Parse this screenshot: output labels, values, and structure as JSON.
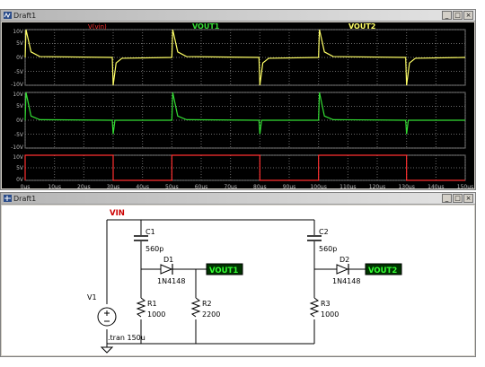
{
  "waveform_window": {
    "title": "Draft1",
    "controls": [
      "_",
      "□",
      "×"
    ],
    "traces": [
      {
        "label": "V(vin)",
        "color": "#ff3030"
      },
      {
        "label": "VOUT1",
        "color": "#33dd33"
      },
      {
        "label": "VOUT2",
        "color": "#ffff66"
      }
    ],
    "pane_ticks": {
      "top": [
        "10V",
        "5V",
        "0V",
        "-5V",
        "-10V"
      ],
      "middle": [
        "10V",
        "5V",
        "0V",
        "-5V",
        "-10V"
      ],
      "bottom": [
        "10V",
        "5V",
        "0V"
      ]
    },
    "x_ticks": [
      "0µs",
      "10µs",
      "20µs",
      "30µs",
      "40µs",
      "50µs",
      "60µs",
      "70µs",
      "80µs",
      "90µs",
      "100µs",
      "110µs",
      "120µs",
      "130µs",
      "140µs",
      "150µs"
    ],
    "colors": {
      "vin": "#ff3030",
      "vout1": "#33dd33",
      "vout2": "#ffff66",
      "grid": "#6a6a6a",
      "tick_text": "#bbbbbb"
    }
  },
  "chart_data": [
    {
      "type": "line",
      "series": [
        {
          "name": "VOUT2",
          "x": [
            0,
            0.3,
            2,
            5,
            29.7,
            30,
            31,
            33,
            50,
            50.3,
            52,
            55,
            79.7,
            80,
            81,
            83,
            100,
            100.3,
            102,
            105,
            129.7,
            130,
            131,
            133,
            150
          ],
          "y": [
            0,
            10,
            2,
            0.3,
            0,
            -10,
            -2,
            -0.3,
            0,
            10,
            2,
            0.3,
            0,
            -10,
            -2,
            -0.3,
            0,
            10,
            2,
            0.3,
            0,
            -10,
            -2,
            -0.3,
            0
          ]
        }
      ],
      "ylim": [
        -10,
        10
      ],
      "xlim": [
        0,
        150
      ]
    },
    {
      "type": "line",
      "series": [
        {
          "name": "VOUT1",
          "x": [
            0,
            0.3,
            2,
            5,
            29.7,
            30,
            30.6,
            50,
            50.3,
            52,
            55,
            79.7,
            80,
            80.6,
            100,
            100.3,
            102,
            105,
            129.7,
            130,
            130.6,
            150
          ],
          "y": [
            0,
            10,
            1.5,
            0.2,
            0,
            -5,
            0,
            0,
            10,
            1.5,
            0.2,
            0,
            -5,
            0,
            0,
            10,
            1.5,
            0.2,
            0,
            -5,
            0,
            0
          ]
        }
      ],
      "ylim": [
        -10,
        10
      ],
      "xlim": [
        0,
        150
      ]
    },
    {
      "type": "line",
      "series": [
        {
          "name": "V(vin)",
          "x": [
            0,
            0,
            30,
            30,
            50,
            50,
            80,
            80,
            100,
            100,
            130,
            130,
            150
          ],
          "y": [
            0,
            10,
            10,
            0,
            0,
            10,
            10,
            0,
            0,
            10,
            10,
            0,
            0
          ]
        }
      ],
      "ylim": [
        0,
        10
      ],
      "xlim": [
        0,
        150
      ]
    }
  ],
  "schematic_window": {
    "title": "Draft1",
    "controls": [
      "_",
      "□",
      "×"
    ],
    "nets": {
      "vin": "VIN",
      "vout1": "VOUT1",
      "vout2": "VOUT2"
    },
    "components": {
      "C1": {
        "name": "C1",
        "value": "560p"
      },
      "C2": {
        "name": "C2",
        "value": "560p"
      },
      "D1": {
        "name": "D1",
        "value": "1N4148"
      },
      "D2": {
        "name": "D2",
        "value": "1N4148"
      },
      "R1": {
        "name": "R1",
        "value": "1000"
      },
      "R2": {
        "name": "R2",
        "value": "2200"
      },
      "R3": {
        "name": "R3",
        "value": "1000"
      },
      "V1": {
        "name": "V1"
      }
    },
    "directive": ".tran 150u"
  }
}
